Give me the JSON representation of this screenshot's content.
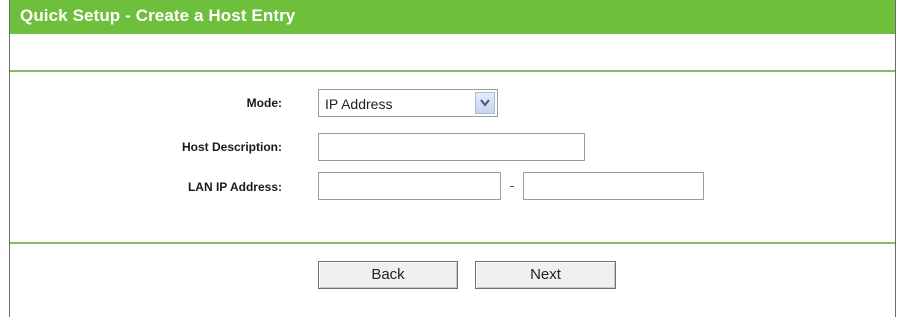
{
  "header": {
    "title": "Quick Setup - Create a Host Entry"
  },
  "form": {
    "mode": {
      "label": "Mode:",
      "selected": "IP Address",
      "arrow_icon": "chevron-down-icon"
    },
    "host_description": {
      "label": "Host Description:",
      "value": ""
    },
    "lan_ip_address": {
      "label": "LAN IP Address:",
      "start_value": "",
      "end_value": "",
      "separator": "-"
    }
  },
  "buttons": {
    "back_label": "Back",
    "next_label": "Next"
  },
  "colors": {
    "title_bar": "#6dbf3c",
    "divider": "#7fbf6a"
  }
}
